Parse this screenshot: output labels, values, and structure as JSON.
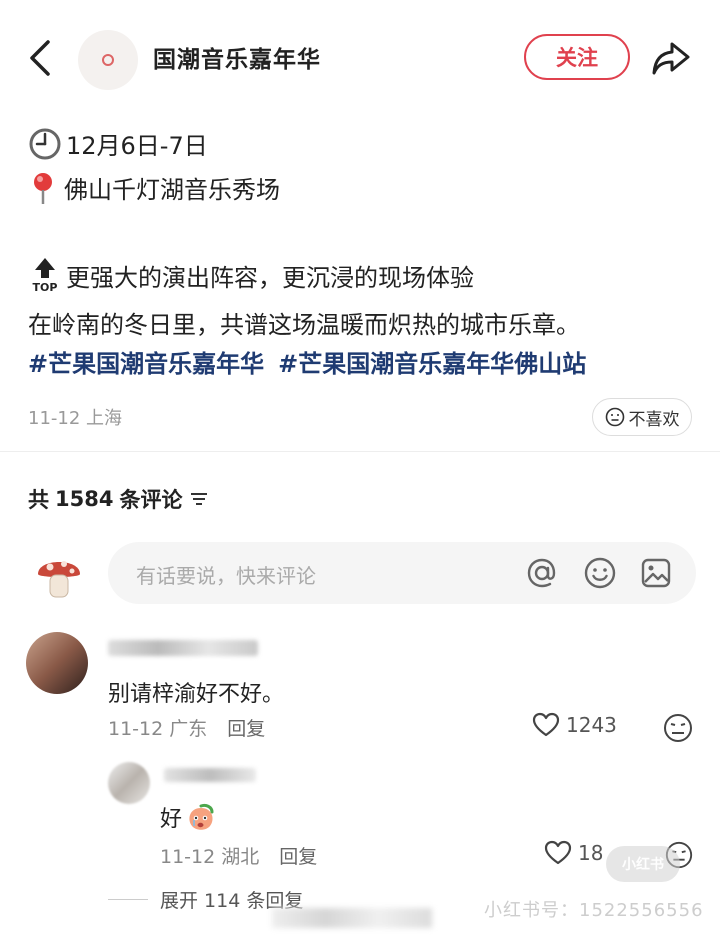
{
  "header": {
    "title": "国潮音乐嘉年华",
    "follow_label": "关注",
    "accent_color": "#e0414e"
  },
  "post": {
    "date_line": "12月6日-7日",
    "location_line": "佛山千灯湖音乐秀场",
    "line1": "更强大的演出阵容，更沉浸的现场体验",
    "line2": "在岭南的冬日里，共谱这场温暖而炽热的城市乐章。",
    "hashtags": [
      "#芒果国潮音乐嘉年华",
      "#芒果国潮音乐嘉年华佛山站"
    ],
    "meta": "11-12 上海",
    "dislike_label": "不喜欢",
    "icons": [
      "clock-icon",
      "pin-icon",
      "top-icon"
    ]
  },
  "comments_header": {
    "prefix": "共",
    "count": "1584",
    "suffix": "条评论"
  },
  "comment_input": {
    "placeholder": "有话要说，快来评论"
  },
  "comments": [
    {
      "text": "别请梓渝好不好。",
      "date": "11-12 广东",
      "reply_label": "回复",
      "likes": "1243"
    }
  ],
  "reply": {
    "text": "好",
    "date": "11-12 湖北",
    "reply_label": "回复",
    "likes": "18"
  },
  "expand": {
    "label": "展开 114 条回复"
  },
  "watermark": {
    "text": "小红书号：1522556556",
    "logo": "小红书"
  }
}
